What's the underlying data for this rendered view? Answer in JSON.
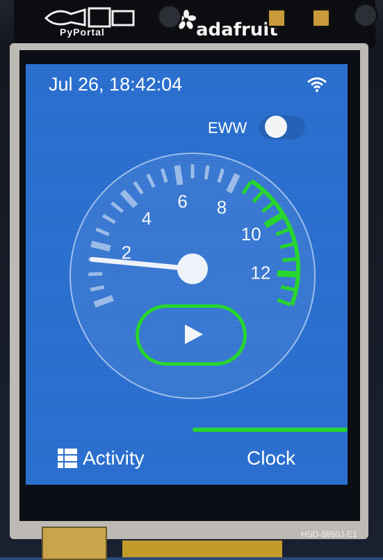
{
  "device": {
    "brand_left": "PyPortal",
    "brand_right": "adafruit",
    "model_label": "HSD-8850J-E1"
  },
  "status_bar": {
    "datetime": "Jul 26, 18:42:04",
    "wifi_icon": "wifi-icon"
  },
  "toggle": {
    "label": "EWW",
    "state": "on"
  },
  "gauge": {
    "tick_labels": [
      "2",
      "4",
      "6",
      "8",
      "10",
      "12"
    ],
    "value": 1.5,
    "min": 0,
    "max": 13,
    "highlight_from": 8.5,
    "accent_color": "#27d52e"
  },
  "play_button": {
    "icon": "play-icon"
  },
  "progress": {
    "value": 0.5,
    "color": "#27d52e"
  },
  "tabs": {
    "activity": {
      "icon": "grid-icon",
      "label": "Activity"
    },
    "clock": {
      "label": "Clock"
    }
  },
  "colors": {
    "screen_bg": "#2d73d6",
    "accent": "#27d52e",
    "text": "#ffffff"
  }
}
